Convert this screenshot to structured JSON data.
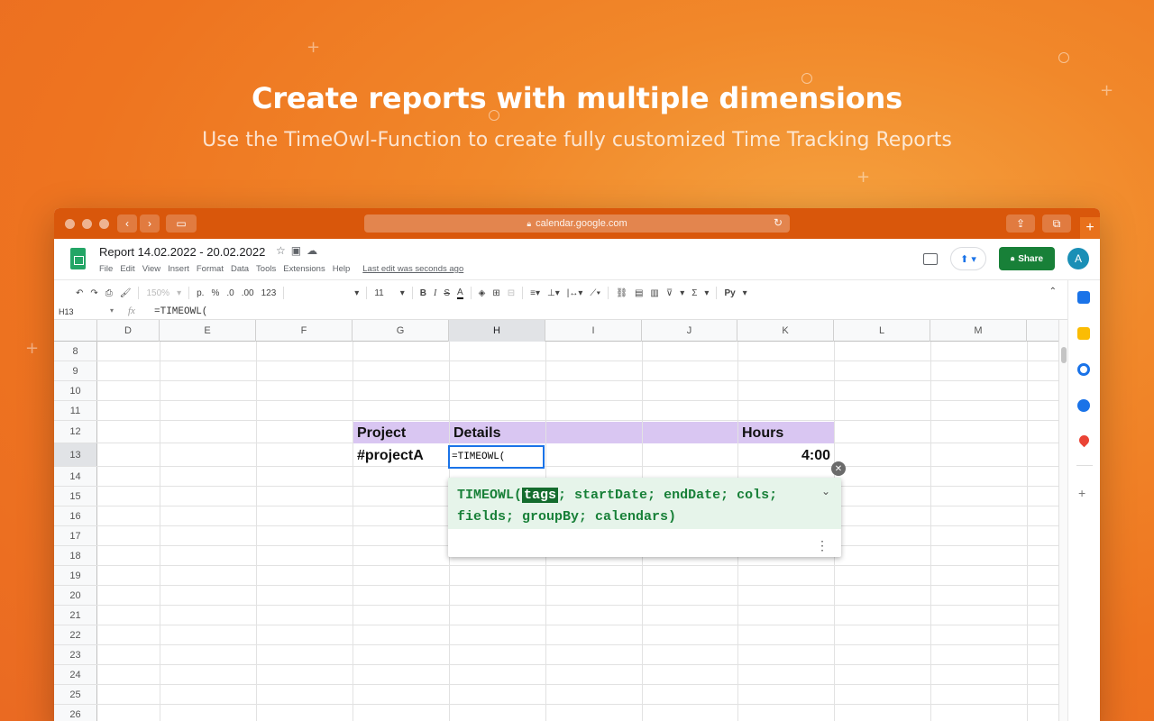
{
  "hero": {
    "title": "Create reports with multiple dimensions",
    "subtitle": "Use the TimeOwl-Function to create fully customized Time Tracking Reports"
  },
  "browser": {
    "url": "calendar.google.com",
    "lock_icon": "lock-icon"
  },
  "doc": {
    "title": "Report 14.02.2022 - 20.02.2022",
    "menu": [
      "File",
      "Edit",
      "View",
      "Insert",
      "Format",
      "Data",
      "Tools",
      "Extensions",
      "Help"
    ],
    "last_edit": "Last edit was seconds ago",
    "share_label": "Share",
    "avatar_letter": "A"
  },
  "toolbar": {
    "zoom": "150%",
    "currency": "p.",
    "percent": "%",
    "dec_less": ".0",
    "dec_more": ".00",
    "format": "123",
    "font_size": "11",
    "bold": "B",
    "italic": "I",
    "strike": "S",
    "text_color": "A",
    "sigma": "Σ",
    "lang": "Py"
  },
  "formula_bar": {
    "name_box": "H13",
    "fx": "fx",
    "formula": "=TIMEOWL("
  },
  "grid": {
    "columns": [
      "D",
      "E",
      "F",
      "G",
      "H",
      "I",
      "J",
      "K",
      "L",
      "M"
    ],
    "rows": [
      "8",
      "9",
      "10",
      "11",
      "12",
      "13",
      "14",
      "15",
      "16",
      "17",
      "18",
      "19",
      "20",
      "21",
      "22",
      "23",
      "24",
      "25",
      "26"
    ],
    "selected_column": "H",
    "selected_row": "13"
  },
  "table": {
    "header_project": "Project",
    "header_details": "Details",
    "header_hours": "Hours",
    "row_project": "#projectA",
    "row_details": "=TIMEOWL(",
    "row_hours": "4:00"
  },
  "autocomplete": {
    "func_name": "TIMEOWL",
    "open_paren": "(",
    "current_arg": "tags",
    "rest_line1": "; startDate; endDate; cols;",
    "line2": "fields; groupBy; calendars)"
  },
  "colors": {
    "highlight": "#d9c6f2",
    "share_green": "#188038",
    "selection_blue": "#1a73e8",
    "accent_orange": "#ee7420"
  }
}
